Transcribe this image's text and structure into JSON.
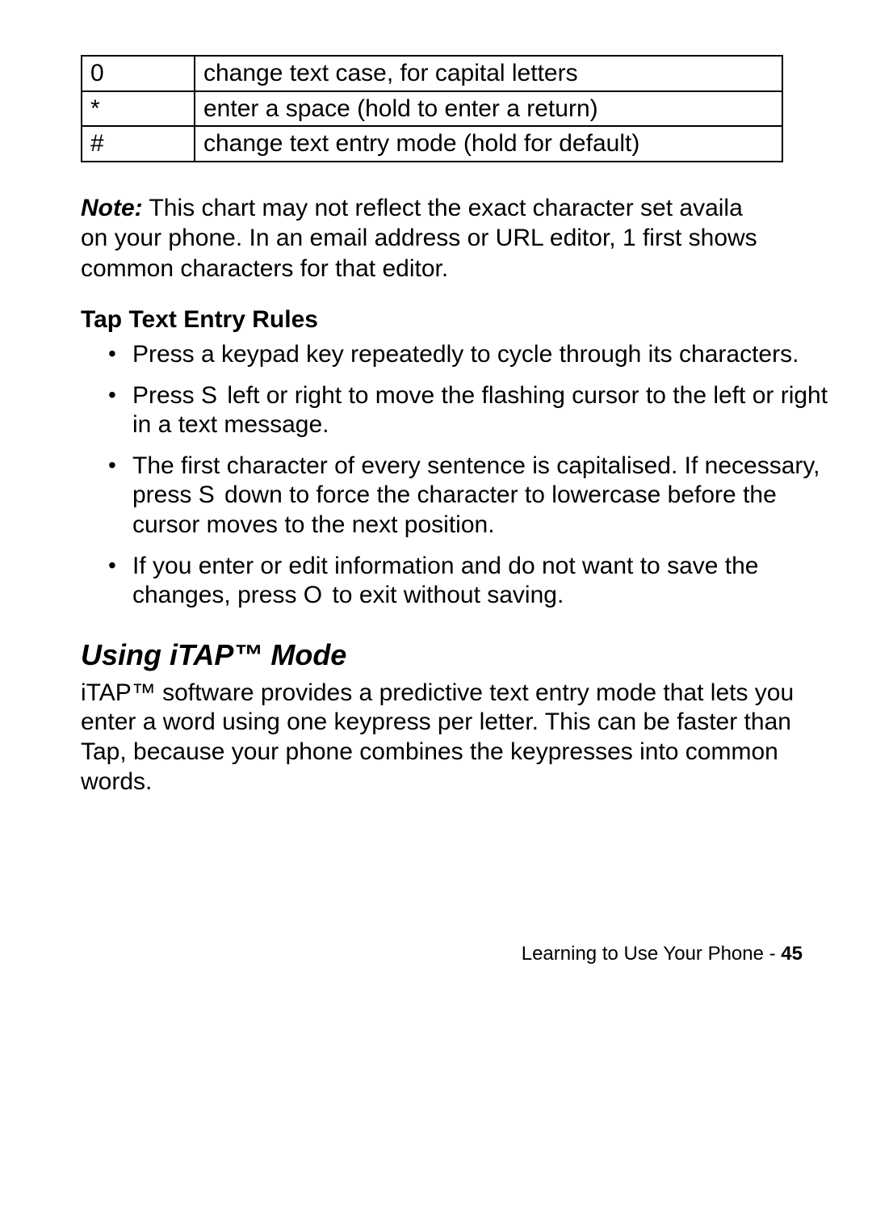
{
  "table": {
    "rows": [
      {
        "key": "0",
        "desc": "change text case, for capital letters"
      },
      {
        "key": "*",
        "desc": "enter a space (hold to enter a return)"
      },
      {
        "key": "#",
        "desc": "change text entry mode (hold for default)"
      }
    ]
  },
  "note": {
    "label": "Note:",
    "text_line1": " This chart may not reflect the exact character set availa",
    "text_line2a": "on your phone. In an email address or URL editor, ",
    "text_line2b": "1",
    "text_line2c": " first shows",
    "text_line3": "common characters for that editor."
  },
  "rules": {
    "heading": "Tap Text Entry Rules",
    "items": [
      {
        "parts": [
          {
            "t": "Press a keypad key repeatedly to cycle through its characters."
          }
        ]
      },
      {
        "parts": [
          {
            "t": "Press "
          },
          {
            "t": "S",
            "cls": "sglyph"
          },
          {
            "t": "  left or right to move the flashing cursor to the left or right in a text message."
          }
        ]
      },
      {
        "parts": [
          {
            "t": "The first character of every sentence is capitalised. If necessary, press "
          },
          {
            "t": "S",
            "cls": "sglyph"
          },
          {
            "t": "  down to force the character to lowercase before the cursor moves to the next position."
          }
        ]
      },
      {
        "parts": [
          {
            "t": "If you enter or edit information and do not want to save the changes, press "
          },
          {
            "t": "O",
            "cls": "sglyph"
          },
          {
            "t": "  to exit without saving."
          }
        ]
      }
    ]
  },
  "section": {
    "heading": "Using iTAP™ Mode",
    "body_parts": [
      {
        "t": "iTAP™ software provides a predictive text entry mode that lets you enter a word using one keypress per letter. This can be faster than "
      },
      {
        "t": "Tap,"
      },
      {
        "t": " because your phone combines the keypresses into common words."
      }
    ]
  },
  "footer": {
    "section": "Learning to Use Your Phone",
    "sep": " - ",
    "page": "45"
  }
}
